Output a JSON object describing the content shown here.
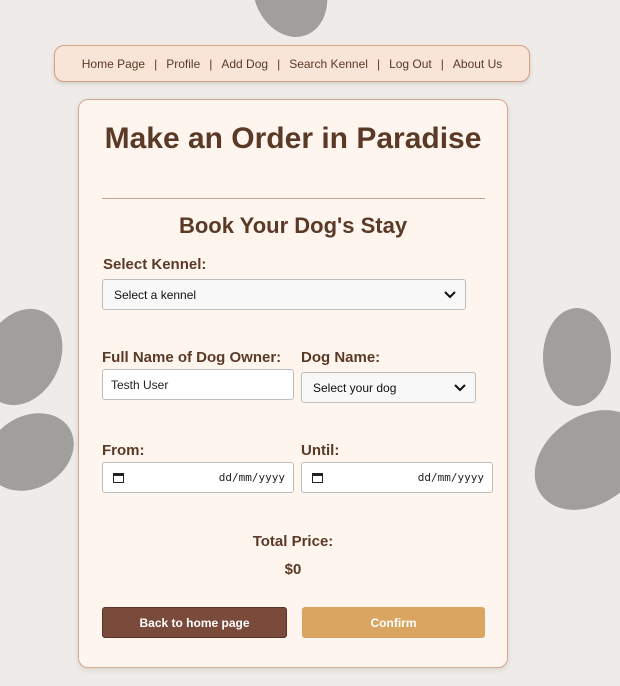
{
  "nav": {
    "items": [
      "Home Page",
      "Profile",
      "Add Dog",
      "Search Kennel",
      "Log Out",
      "About Us"
    ],
    "separator": "|"
  },
  "form": {
    "title": "Make an Order in Paradise",
    "subtitle": "Book Your Dog's Stay",
    "kennel_label": "Select Kennel:",
    "kennel_value": "Select a kennel",
    "owner_label": "Full Name of Dog Owner:",
    "owner_value": "Testh User",
    "dog_label": "Dog Name:",
    "dog_value": "Select your dog",
    "from_label": "From:",
    "until_label": "Until:",
    "date_placeholder": "dd/mm/yyyy",
    "total_label": "Total Price:",
    "total_value": "$0",
    "back_button": "Back to home page",
    "confirm_button": "Confirm"
  },
  "colors": {
    "background": "#efebe8",
    "card": "#fff5ef",
    "nav": "#f9e4d8",
    "text": "#5a3a26",
    "back_button": "#7a4a3a",
    "confirm_button": "#d9a560",
    "paw": "#a19e9e"
  }
}
